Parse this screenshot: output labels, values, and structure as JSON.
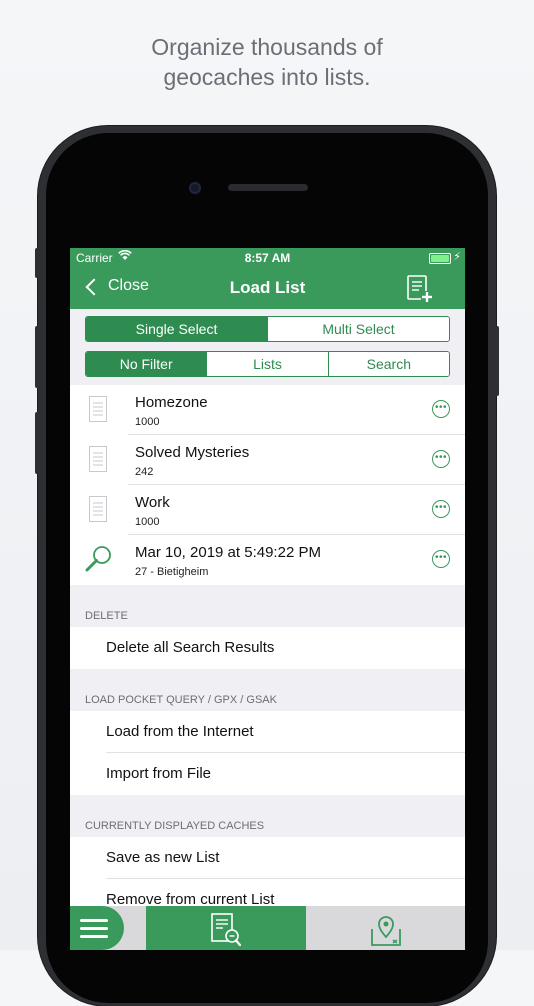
{
  "headline": {
    "line1": "Organize thousands of",
    "line2": "geocaches into lists."
  },
  "status_bar": {
    "carrier": "Carrier",
    "time": "8:57 AM"
  },
  "nav": {
    "back_label": "Close",
    "title": "Load List"
  },
  "select_mode": {
    "options": [
      "Single Select",
      "Multi Select"
    ],
    "selected": "Single Select"
  },
  "filter": {
    "options": [
      "No Filter",
      "Lists",
      "Search"
    ],
    "selected": "No Filter"
  },
  "lists": [
    {
      "title": "Homezone",
      "subtitle": "1000",
      "icon": "document-icon"
    },
    {
      "title": "Solved Mysteries",
      "subtitle": "242",
      "icon": "document-icon"
    },
    {
      "title": "Work",
      "subtitle": "1000",
      "icon": "document-icon"
    },
    {
      "title": "Mar 10, 2019 at 5:49:22 PM",
      "subtitle": "27 - Bietigheim",
      "icon": "magnifier-icon"
    }
  ],
  "sections": {
    "delete": {
      "header": "DELETE",
      "items": [
        "Delete all Search Results"
      ]
    },
    "load": {
      "header": "LOAD POCKET QUERY / GPX / GSAK",
      "items": [
        "Load from the Internet",
        "Import from File"
      ]
    },
    "current": {
      "header": "CURRENTLY DISPLAYED CACHES",
      "items": [
        "Save as new List",
        "Remove from current List"
      ]
    }
  },
  "colors": {
    "brand_green": "#3a9a5b",
    "segment_green": "#2e8c50"
  },
  "tab_bar": {
    "icons": [
      "menu-icon",
      "list-search-icon",
      "map-pin-icon"
    ]
  }
}
